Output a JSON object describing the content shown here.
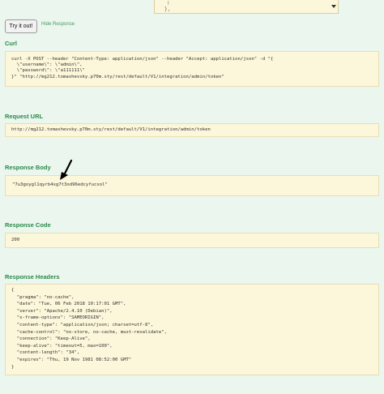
{
  "top_textarea": {
    "line1": "!",
    "line2": "},"
  },
  "actions": {
    "try_button": "Try it out!",
    "hide_link": "Hide Response"
  },
  "curl": {
    "title": "Curl",
    "lines": [
      "curl -X POST --header \"Content-Type: application/json\" --header \"Accept: application/json\" -d \"{",
      "  \\\"username\\\": \\\"admin\\\",",
      "  \\\"password\\\": \\\"a111111\\\"",
      "}\" \"http://mg212.tomashevsky.p70m.sty/rest/default/V1/integration/admin/token\""
    ]
  },
  "request_url": {
    "title": "Request URL",
    "value": "http://mg212.tomashevsky.p70m.sty/rest/default/V1/integration/admin/token"
  },
  "response_body": {
    "title": "Response Body",
    "value": "\"7u3goygl1qyrb4xg7t3od96edcyfucxol\""
  },
  "response_code": {
    "title": "Response Code",
    "value": "200"
  },
  "response_headers": {
    "title": "Response Headers",
    "lines": [
      "{",
      "  \"pragma\": \"no-cache\",",
      "  \"date\": \"Tue, 06 Feb 2018 10:17:01 GMT\",",
      "  \"server\": \"Apache/2.4.10 (Debian)\",",
      "  \"x-frame-options\": \"SAMEORIGIN\",",
      "  \"content-type\": \"application/json; charset=utf-8\",",
      "  \"cache-control\": \"no-store, no-cache, must-revalidate\",",
      "  \"connection\": \"Keep-Alive\",",
      "  \"keep-alive\": \"timeout=5, max=100\",",
      "  \"content-length\": \"34\",",
      "  \"expires\": \"Thu, 19 Nov 1981 08:52:00 GMT\"",
      "}"
    ]
  },
  "colors": {
    "page_bg": "#eaf6ee",
    "box_bg": "#fcf6db",
    "title_green": "#2b8a48",
    "link_green": "#4e9a62"
  },
  "icons": {
    "annotation": "arrow-pointer-icon",
    "dropdown": "triangle-down-icon"
  }
}
